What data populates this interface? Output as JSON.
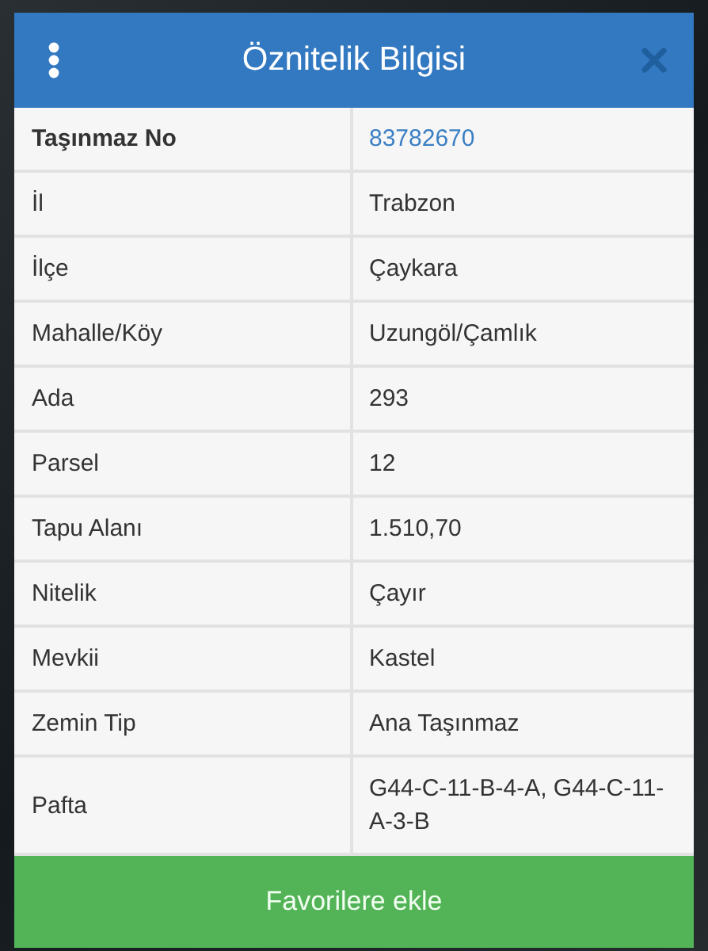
{
  "dialog": {
    "title": "Öznitelik Bilgisi"
  },
  "rows": [
    {
      "kind": "key",
      "label": "Taşınmaz No",
      "value": "83782670"
    },
    {
      "kind": "plain",
      "label": "İl",
      "value": "Trabzon"
    },
    {
      "kind": "plain",
      "label": "İlçe",
      "value": "Çaykara"
    },
    {
      "kind": "plain",
      "label": "Mahalle/Köy",
      "value": "Uzungöl/Çamlık"
    },
    {
      "kind": "plain",
      "label": "Ada",
      "value": "293"
    },
    {
      "kind": "plain",
      "label": "Parsel",
      "value": "12"
    },
    {
      "kind": "plain",
      "label": "Tapu Alanı",
      "value": "1.510,70"
    },
    {
      "kind": "plain",
      "label": "Nitelik",
      "value": "Çayır"
    },
    {
      "kind": "plain",
      "label": "Mevkii",
      "value": "Kastel"
    },
    {
      "kind": "plain",
      "label": "Zemin Tip",
      "value": "Ana Taşınmaz"
    },
    {
      "kind": "plain",
      "label": "Pafta",
      "value": "G44-C-11-B-4-A,   G44-C-11-A-3-B"
    }
  ],
  "button": "Favorilere ekle"
}
